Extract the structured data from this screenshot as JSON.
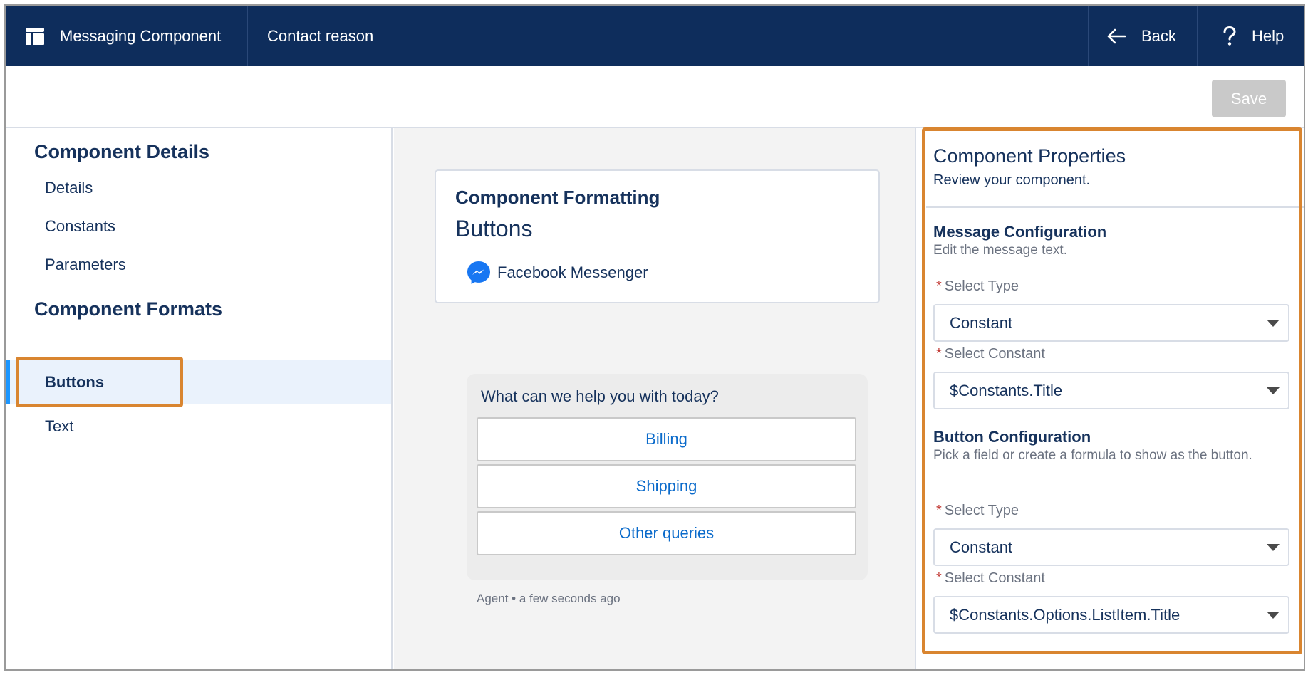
{
  "topbar": {
    "app_title": "Messaging Component",
    "page_title": "Contact reason",
    "back_label": "Back",
    "help_label": "Help"
  },
  "actionbar": {
    "save_label": "Save"
  },
  "sidebar": {
    "details_heading": "Component Details",
    "details_items": [
      {
        "label": "Details"
      },
      {
        "label": "Constants"
      },
      {
        "label": "Parameters"
      }
    ],
    "formats_heading": "Component Formats",
    "format_items": [
      {
        "label": "Buttons",
        "active": true
      },
      {
        "label": "Text",
        "active": false
      }
    ]
  },
  "preview": {
    "card_title": "Component Formatting",
    "card_subtitle": "Buttons",
    "channel": "Facebook Messenger",
    "chat_question": "What can we help you with today?",
    "chat_buttons": [
      {
        "label": "Billing"
      },
      {
        "label": "Shipping"
      },
      {
        "label": "Other queries"
      }
    ],
    "chat_meta": "Agent • a few seconds ago"
  },
  "properties": {
    "title": "Component Properties",
    "subtitle": "Review your component.",
    "message_config": {
      "title": "Message Configuration",
      "description": "Edit the message text.",
      "type_label": "Select Type",
      "type_value": "Constant",
      "constant_label": "Select Constant",
      "constant_value": "$Constants.Title"
    },
    "button_config": {
      "title": "Button Configuration",
      "description": "Pick a field or create a formula to show as the button.",
      "type_label": "Select Type",
      "type_value": "Constant",
      "constant_label": "Select Constant",
      "constant_value": "$Constants.Options.ListItem.Title"
    }
  },
  "colors": {
    "topbar": "#0e2d5c",
    "highlight": "#d98530",
    "link": "#0b6bcb",
    "required": "#c23934",
    "messenger": "#1877f2"
  }
}
